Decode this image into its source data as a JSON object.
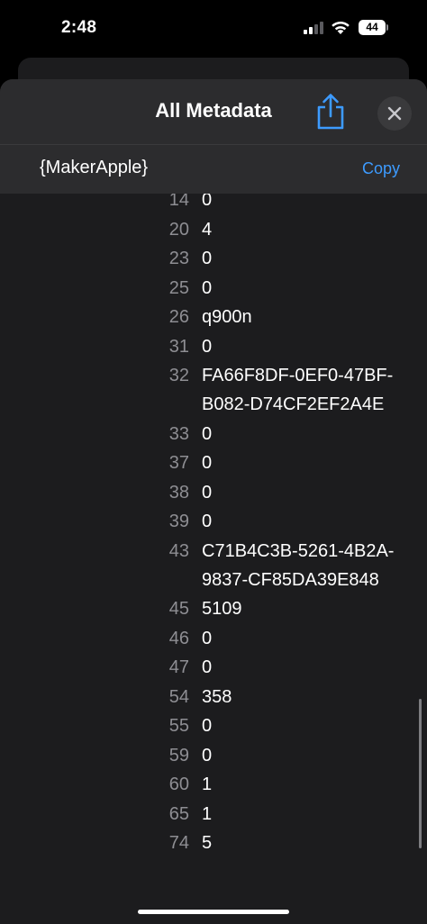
{
  "status_bar": {
    "time": "2:48",
    "battery": "44"
  },
  "header": {
    "title": "All Metadata"
  },
  "section": {
    "title": "{MakerApple}",
    "copy_label": "Copy"
  },
  "rows": [
    {
      "key": "14",
      "value": "0"
    },
    {
      "key": "20",
      "value": "4"
    },
    {
      "key": "23",
      "value": "0"
    },
    {
      "key": "25",
      "value": "0"
    },
    {
      "key": "26",
      "value": "q900n"
    },
    {
      "key": "31",
      "value": "0"
    },
    {
      "key": "32",
      "value": "FA66F8DF-0EF0-47BF-B082-D74CF2EF2A4E"
    },
    {
      "key": "33",
      "value": "0"
    },
    {
      "key": "37",
      "value": "0"
    },
    {
      "key": "38",
      "value": "0"
    },
    {
      "key": "39",
      "value": "0"
    },
    {
      "key": "43",
      "value": "C71B4C3B-5261-4B2A-9837-CF85DA39E848"
    },
    {
      "key": "45",
      "value": "5109"
    },
    {
      "key": "46",
      "value": "0"
    },
    {
      "key": "47",
      "value": "0"
    },
    {
      "key": "54",
      "value": "358"
    },
    {
      "key": "55",
      "value": "0"
    },
    {
      "key": "59",
      "value": "0"
    },
    {
      "key": "60",
      "value": "1"
    },
    {
      "key": "65",
      "value": "1"
    },
    {
      "key": "74",
      "value": "5"
    }
  ],
  "icons": {
    "share": "share-icon",
    "close": "close-icon",
    "signal": "cellular-signal-icon",
    "wifi": "wifi-icon",
    "battery": "battery-icon"
  },
  "colors": {
    "accent": "#3d9bff",
    "background": "#1c1c1e",
    "header": "#2c2c2e",
    "key_text": "#8e8e93"
  }
}
